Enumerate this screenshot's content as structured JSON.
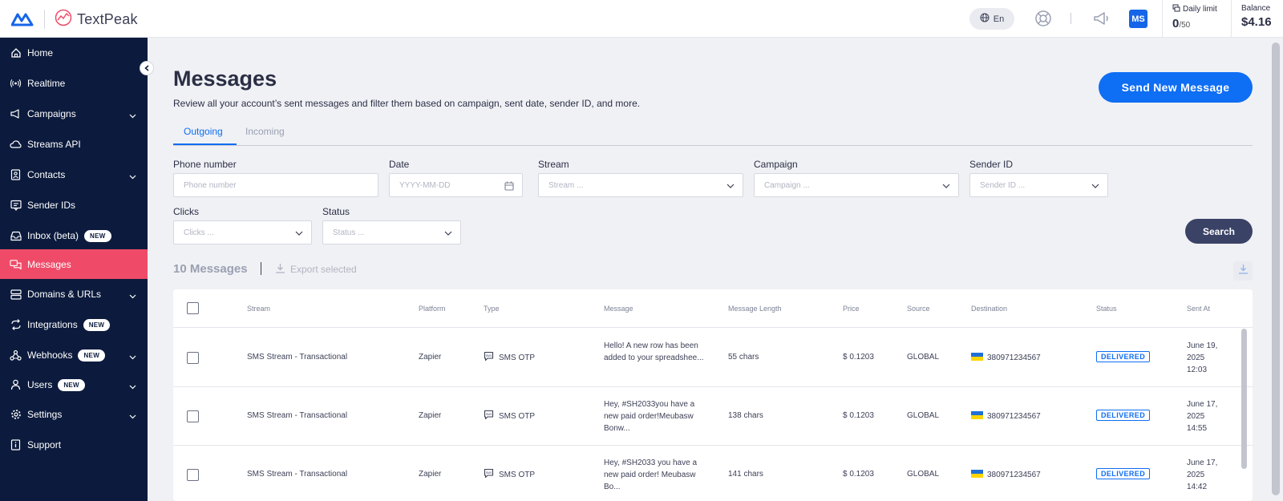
{
  "header": {
    "brand": "TextPeak",
    "language": "En",
    "avatar_initials": "MS",
    "daily_limit_label": "Daily limit",
    "daily_limit_used": "0",
    "daily_limit_total": "/50",
    "balance_label": "Balance",
    "balance_value": "$4.16"
  },
  "sidebar": {
    "items": [
      {
        "label": "Home",
        "icon": "home-icon"
      },
      {
        "label": "Realtime",
        "icon": "broadcast-icon"
      },
      {
        "label": "Campaigns",
        "icon": "megaphone-icon",
        "expandable": true
      },
      {
        "label": "Streams API",
        "icon": "cloud-icon"
      },
      {
        "label": "Contacts",
        "icon": "contacts-icon",
        "expandable": true
      },
      {
        "label": "Sender IDs",
        "icon": "sender-id-icon"
      },
      {
        "label": "Inbox (beta)",
        "icon": "inbox-icon",
        "badge": "NEW"
      },
      {
        "label": "Messages",
        "icon": "messages-icon",
        "active": true
      },
      {
        "label": "Domains & URLs",
        "icon": "domains-icon",
        "expandable": true
      },
      {
        "label": "Integrations",
        "icon": "integrations-icon",
        "badge": "NEW"
      },
      {
        "label": "Webhooks",
        "icon": "webhooks-icon",
        "badge": "NEW",
        "expandable": true
      },
      {
        "label": "Users",
        "icon": "user-icon",
        "badge": "NEW",
        "expandable": true
      },
      {
        "label": "Settings",
        "icon": "gear-icon",
        "expandable": true
      },
      {
        "label": "Support",
        "icon": "support-icon"
      }
    ]
  },
  "page": {
    "title": "Messages",
    "subtitle": "Review all your account’s sent messages and filter them based on campaign, sent date, sender ID, and more.",
    "send_button": "Send New Message"
  },
  "tabs": [
    {
      "label": "Outgoing",
      "active": true
    },
    {
      "label": "Incoming",
      "active": false
    }
  ],
  "filters": {
    "phone": {
      "label": "Phone number",
      "placeholder": "Phone number"
    },
    "date": {
      "label": "Date",
      "placeholder": "YYYY-MM-DD"
    },
    "stream": {
      "label": "Stream",
      "placeholder": "Stream ..."
    },
    "campaign": {
      "label": "Campaign",
      "placeholder": "Campaign ..."
    },
    "sender": {
      "label": "Sender ID",
      "placeholder": "Sender ID ..."
    },
    "clicks": {
      "label": "Clicks",
      "placeholder": "Clicks ..."
    },
    "status": {
      "label": "Status",
      "placeholder": "Status ..."
    },
    "search_button": "Search"
  },
  "results": {
    "count": "10 Messages",
    "export_label": "Export selected"
  },
  "table": {
    "columns": [
      "Stream",
      "Platform",
      "Type",
      "Message",
      "Message Length",
      "Price",
      "Source",
      "Destination",
      "Status",
      "Sent At"
    ],
    "rows": [
      {
        "stream": "SMS Stream - Transactional",
        "platform": "Zapier",
        "type": "SMS OTP",
        "message": "Hello! A new row has been added to your spreadshee...",
        "length": "55 chars",
        "price": "$ 0.1203",
        "source": "GLOBAL",
        "destination": "380971234567",
        "status": "DELIVERED",
        "sent_at": "June 19, 2025 12:03"
      },
      {
        "stream": "SMS Stream - Transactional",
        "platform": "Zapier",
        "type": "SMS OTP",
        "message": "Hey, #SH2033you have a new paid order!Meubasw Bonw...",
        "length": "138 chars",
        "price": "$ 0.1203",
        "source": "GLOBAL",
        "destination": "380971234567",
        "status": "DELIVERED",
        "sent_at": "June 17, 2025 14:55"
      },
      {
        "stream": "SMS Stream - Transactional",
        "platform": "Zapier",
        "type": "SMS OTP",
        "message": "Hey, #SH2033 you have a new paid order! Meubasw Bo...",
        "length": "141 chars",
        "price": "$ 0.1203",
        "source": "GLOBAL",
        "destination": "380971234567",
        "status": "DELIVERED",
        "sent_at": "June 17, 2025 14:42"
      }
    ]
  },
  "colors": {
    "sidebar_bg": "#0c1b3d",
    "active_item": "#ef4b68",
    "primary": "#0e6ef4",
    "search_button": "#3a4266"
  }
}
